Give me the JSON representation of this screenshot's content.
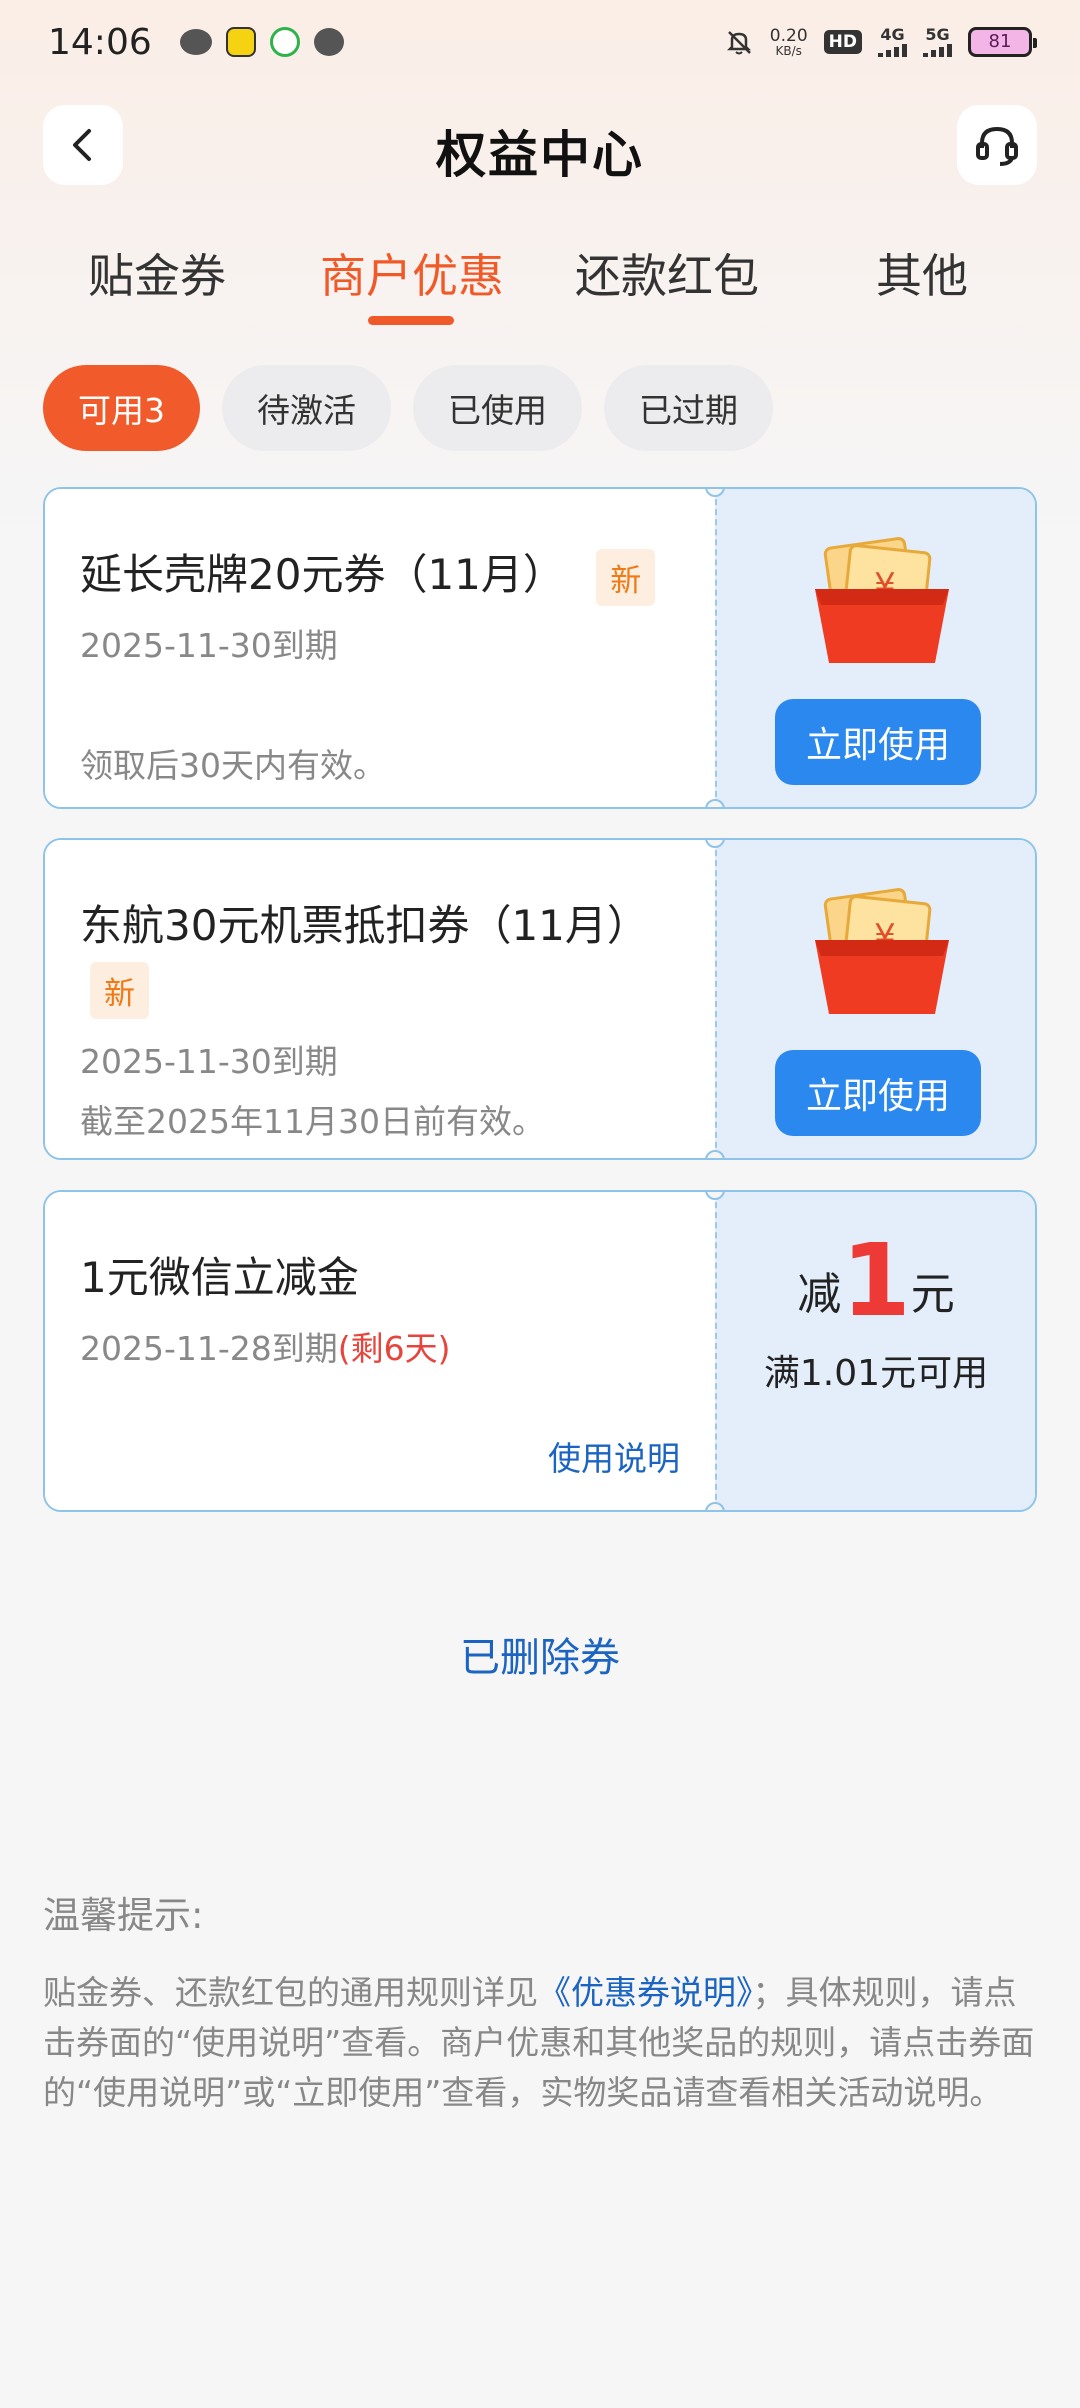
{
  "status_bar": {
    "time": "14:06",
    "net_speed_value": "0.20",
    "net_speed_unit": "KB/s",
    "hd": "HD",
    "sim1_type": "4G",
    "sim2_type": "5G",
    "battery": "81"
  },
  "header": {
    "title": "权益中心"
  },
  "tabs": [
    {
      "label": "贴金券",
      "active": false
    },
    {
      "label": "商户优惠",
      "active": true
    },
    {
      "label": "还款红包",
      "active": false
    },
    {
      "label": "其他",
      "active": false
    }
  ],
  "filters": [
    {
      "label": "可用3",
      "active": true
    },
    {
      "label": "待激活",
      "active": false
    },
    {
      "label": "已使用",
      "active": false
    },
    {
      "label": "已过期",
      "active": false
    }
  ],
  "coupons": [
    {
      "title": "延长壳牌20元券（11月）",
      "new_tag": "新",
      "expire": "2025-11-30到期",
      "note": "领取后30天内有效。",
      "button": "立即使用"
    },
    {
      "title": "东航30元机票抵扣券（11月）",
      "new_tag": "新",
      "expire": "2025-11-30到期",
      "note": "截至2025年11月30日前有效。",
      "button": "立即使用"
    },
    {
      "title": "1元微信立减金",
      "expire": "2025-11-28到期",
      "days_left": "(剩6天)",
      "link": "使用说明",
      "reduce_prefix": "减",
      "reduce_amount": "1",
      "reduce_suffix": "元",
      "condition": "满1.01元可用"
    }
  ],
  "deleted_link": "已删除券",
  "tips": {
    "title": "温馨提示:",
    "body_1": "贴金券、还款红包的通用规则详见",
    "link": "《优惠券说明》",
    "body_2": "；具体规则，请点击券面的“使用说明”查看。商户优惠和其他奖品的规则，请点击券面的“使用说明”或“立即使用”查看，实物奖品请查看相关活动说明。"
  },
  "colors": {
    "accent": "#f05a28",
    "primary_button": "#2b88ef",
    "link": "#1b64c2",
    "coupon_border": "#8ec3ea",
    "coupon_right_bg": "#e3eefa"
  }
}
